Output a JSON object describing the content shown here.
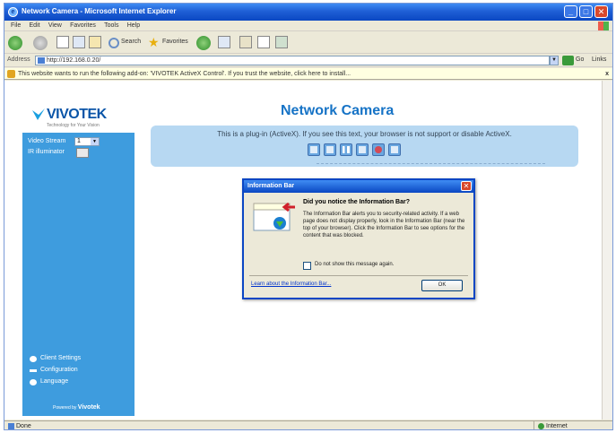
{
  "window": {
    "title": "Network Camera - Microsoft Internet Explorer",
    "minimize": "_",
    "maximize": "□",
    "close": "✕"
  },
  "menu": [
    "File",
    "Edit",
    "View",
    "Favorites",
    "Tools",
    "Help"
  ],
  "toolbar": {
    "search_label": "Search",
    "favorites_label": "Favorites"
  },
  "address": {
    "label": "Address",
    "value": "http://192.168.0.20/",
    "go_label": "Go",
    "links_label": "Links"
  },
  "infobar": {
    "text": "This website wants to run the following add-on: 'VIVOTEK ActiveX Control'. If you trust the website, click here to install...",
    "close": "x"
  },
  "sidebar": {
    "brand": "VIVOTEK",
    "brand_tagline": "Technology for Your Vision",
    "video_stream_label": "Video Stream",
    "video_stream_value": "1",
    "ir_illuminator_label": "IR illuminator",
    "links": [
      "Client Settings",
      "Configuration",
      "Language"
    ],
    "powered_prefix": "Powered by",
    "powered_brand": "Vivotek"
  },
  "main": {
    "title": "Network Camera",
    "plugin_text": "This is a plug-in (ActiveX). If you see this text, your browser is not support or disable ActiveX."
  },
  "dialog": {
    "title": "Information Bar",
    "close": "✕",
    "heading": "Did you notice the Information Bar?",
    "body": "The Information Bar alerts you to security-related activity. If a web page does not display properly, look in the Information Bar (near the top of your browser). Click the Information Bar to see options for the content that was blocked.",
    "checkbox_label": "Do not show this message again.",
    "link": "Learn about the Information Bar...",
    "ok_label": "OK"
  },
  "status": {
    "left": "Done",
    "zone": "Internet"
  }
}
